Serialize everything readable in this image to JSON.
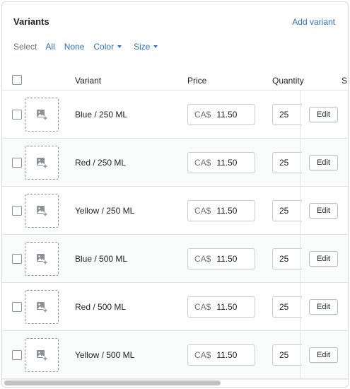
{
  "card": {
    "title": "Variants",
    "add_variant_label": "Add variant"
  },
  "select_bar": {
    "label": "Select",
    "options": [
      "All",
      "None",
      "Color",
      "Size"
    ]
  },
  "table": {
    "headers": {
      "variant": "Variant",
      "price": "Price",
      "quantity": "Quantity",
      "sku_partial": "S"
    },
    "rows": [
      {
        "name": "Blue / 250 ML",
        "currency": "CA$",
        "price": "11.50",
        "quantity": "25",
        "edit": "Edit"
      },
      {
        "name": "Red / 250 ML",
        "currency": "CA$",
        "price": "11.50",
        "quantity": "25",
        "edit": "Edit"
      },
      {
        "name": "Yellow / 250 ML",
        "currency": "CA$",
        "price": "11.50",
        "quantity": "25",
        "edit": "Edit"
      },
      {
        "name": "Blue / 500 ML",
        "currency": "CA$",
        "price": "11.50",
        "quantity": "25",
        "edit": "Edit"
      },
      {
        "name": "Red / 500 ML",
        "currency": "CA$",
        "price": "11.50",
        "quantity": "25",
        "edit": "Edit"
      },
      {
        "name": "Yellow / 500 ML",
        "currency": "CA$",
        "price": "11.50",
        "quantity": "25",
        "edit": "Edit"
      }
    ]
  },
  "colors": {
    "link": "#2c6ecb",
    "border": "#e1e3e5",
    "text": "#202223",
    "muted": "#6d7175"
  },
  "icons": {
    "image_placeholder": "add-image-icon",
    "dropdown": "caret-down-icon"
  }
}
